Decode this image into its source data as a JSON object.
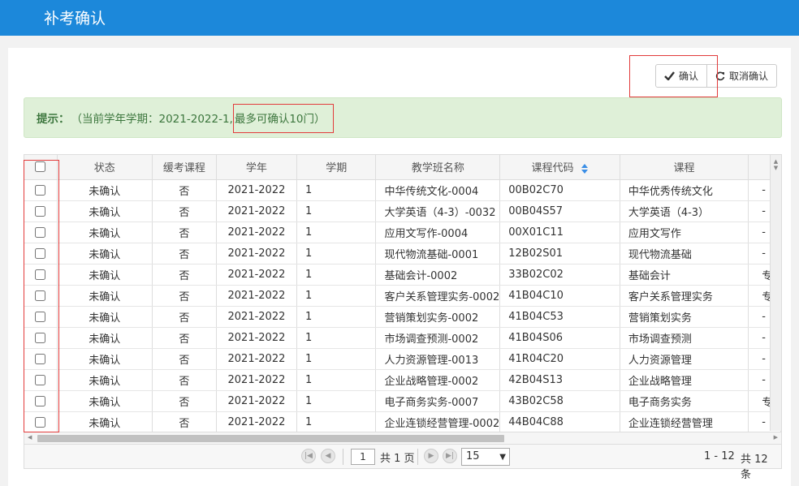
{
  "header": {
    "title": "补考确认"
  },
  "toolbar": {
    "confirm_label": "确认",
    "cancel_label": "取消确认"
  },
  "hint": {
    "prefix": "提示：",
    "text": "（当前学年学期：2021-2022-1, ",
    "highlight": "最多可确认10门）"
  },
  "table": {
    "columns": [
      "状态",
      "缓考课程",
      "学年",
      "学期",
      "教学班名称",
      "课程代码",
      "课程"
    ],
    "rows": [
      {
        "status": "未确认",
        "deferred": "否",
        "year": "2021-2022",
        "term": "1",
        "class_name": "中华传统文化-0004",
        "code": "00B02C70",
        "course": "中华优秀传统文化",
        "extra": "-"
      },
      {
        "status": "未确认",
        "deferred": "否",
        "year": "2021-2022",
        "term": "1",
        "class_name": "大学英语（4-3）-0032",
        "code": "00B04S57",
        "course": "大学英语（4-3）",
        "extra": "-"
      },
      {
        "status": "未确认",
        "deferred": "否",
        "year": "2021-2022",
        "term": "1",
        "class_name": "应用文写作-0004",
        "code": "00X01C11",
        "course": "应用文写作",
        "extra": "-"
      },
      {
        "status": "未确认",
        "deferred": "否",
        "year": "2021-2022",
        "term": "1",
        "class_name": "现代物流基础-0001",
        "code": "12B02S01",
        "course": "现代物流基础",
        "extra": "-"
      },
      {
        "status": "未确认",
        "deferred": "否",
        "year": "2021-2022",
        "term": "1",
        "class_name": "基础会计-0002",
        "code": "33B02C02",
        "course": "基础会计",
        "extra": "专"
      },
      {
        "status": "未确认",
        "deferred": "否",
        "year": "2021-2022",
        "term": "1",
        "class_name": "客户关系管理实务-0002",
        "code": "41B04C10",
        "course": "客户关系管理实务",
        "extra": "专"
      },
      {
        "status": "未确认",
        "deferred": "否",
        "year": "2021-2022",
        "term": "1",
        "class_name": "营销策划实务-0002",
        "code": "41B04C53",
        "course": "营销策划实务",
        "extra": "-"
      },
      {
        "status": "未确认",
        "deferred": "否",
        "year": "2021-2022",
        "term": "1",
        "class_name": "市场调查预测-0002",
        "code": "41B04S06",
        "course": "市场调查预测",
        "extra": "-"
      },
      {
        "status": "未确认",
        "deferred": "否",
        "year": "2021-2022",
        "term": "1",
        "class_name": "人力资源管理-0013",
        "code": "41R04C20",
        "course": "人力资源管理",
        "extra": "-"
      },
      {
        "status": "未确认",
        "deferred": "否",
        "year": "2021-2022",
        "term": "1",
        "class_name": "企业战略管理-0002",
        "code": "42B04S13",
        "course": "企业战略管理",
        "extra": "-"
      },
      {
        "status": "未确认",
        "deferred": "否",
        "year": "2021-2022",
        "term": "1",
        "class_name": "电子商务实务-0007",
        "code": "43B02C58",
        "course": "电子商务实务",
        "extra": "专"
      },
      {
        "status": "未确认",
        "deferred": "否",
        "year": "2021-2022",
        "term": "1",
        "class_name": "企业连锁经营管理-0002",
        "code": "44B04C88",
        "course": "企业连锁经营管理",
        "extra": "-"
      }
    ]
  },
  "pager": {
    "page": "1",
    "total_pages": "共 1 页",
    "page_size": "15",
    "range": "1 - 12",
    "total": "共 12 条"
  }
}
